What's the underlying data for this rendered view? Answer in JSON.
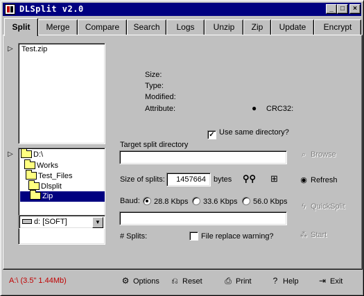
{
  "window": {
    "title": "DLSplit v2.0",
    "min": "_",
    "max": "□",
    "close": "×"
  },
  "tabs": [
    {
      "label": "Split"
    },
    {
      "label": "Merge"
    },
    {
      "label": "Compare"
    },
    {
      "label": "Search"
    },
    {
      "label": "Logs"
    },
    {
      "label": "Unzip"
    },
    {
      "label": "Zip"
    },
    {
      "label": "Update"
    },
    {
      "label": "Encrypt"
    }
  ],
  "file_list": {
    "items": [
      "Test.zip"
    ]
  },
  "file_info": {
    "size_label": "Size:",
    "type_label": "Type:",
    "modified_label": "Modified:",
    "attribute_label": "Attribute:",
    "crc_label": "CRC32:"
  },
  "tree": [
    {
      "label": "D:\\"
    },
    {
      "label": "Works"
    },
    {
      "label": "Test_Files"
    },
    {
      "label": "Dlsplit"
    },
    {
      "label": "Zip"
    }
  ],
  "drive": {
    "value": "d: [SOFT]"
  },
  "options": {
    "same_dir_label": "Use same directory?",
    "target_dir_label": "Target split directory",
    "target_dir_value": "",
    "split_size_label": "Size of splits:",
    "split_size_value": "1457664",
    "split_size_unit": "bytes",
    "baud_label": "Baud:",
    "baud_options": [
      "28.8 Kbps",
      "33.6 Kbps",
      "56.0 Kbps"
    ],
    "splits_label": "# Splits:",
    "replace_warning_label": "File replace warning?"
  },
  "actions": {
    "browse": "Browse",
    "refresh": "Refresh",
    "quicksplit": "QuickSplit",
    "start": "Start"
  },
  "status": {
    "text": "A:\\ (3.5\" 1.44Mb)"
  },
  "bottom": {
    "options": "Options",
    "reset": "Reset",
    "print": "Print",
    "help": "Help",
    "exit": "Exit"
  },
  "colors": {
    "titlebar": "#000080",
    "status": "#c00000",
    "selection": "#000080"
  }
}
